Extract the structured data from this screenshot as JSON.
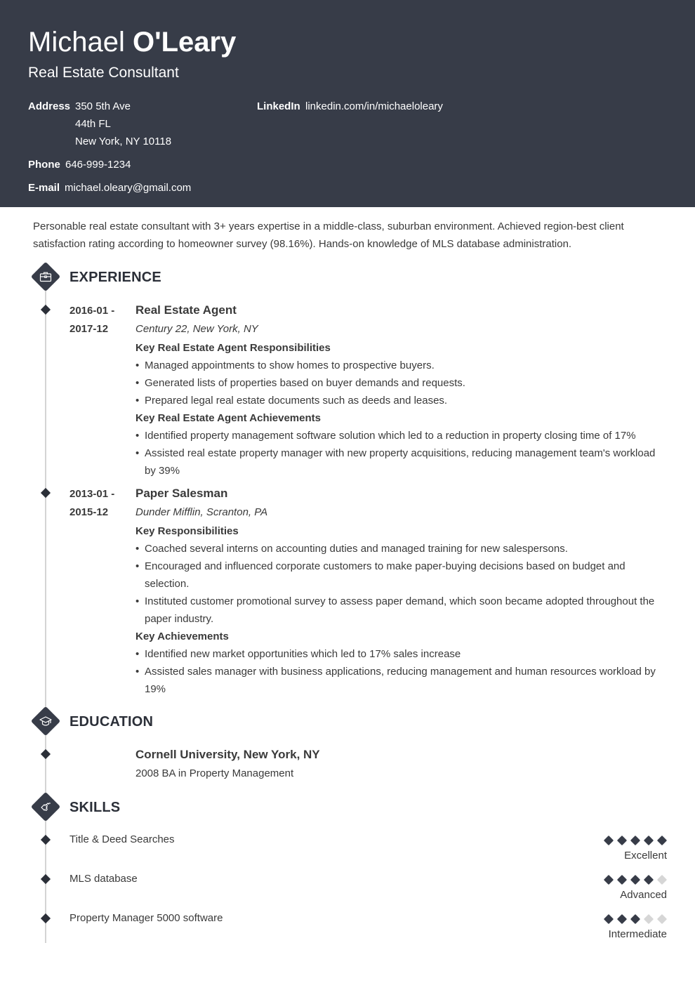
{
  "header": {
    "first_name": "Michael",
    "last_name": "O'Leary",
    "job_title": "Real Estate Consultant",
    "contact": {
      "address_label": "Address",
      "address_lines": [
        "350 5th Ave",
        "44th FL",
        "New York, NY 10118"
      ],
      "linkedin_label": "LinkedIn",
      "linkedin": "linkedin.com/in/michaeloleary",
      "phone_label": "Phone",
      "phone": "646-999-1234",
      "email_label": "E-mail",
      "email": "michael.oleary@gmail.com"
    }
  },
  "summary": "Personable real estate consultant with 3+ years expertise in a middle-class, suburban environment. Achieved region-best client satisfaction rating according to homeowner survey (98.16%). Hands-on knowledge of MLS database administration.",
  "sections": {
    "experience": "EXPERIENCE",
    "education": "EDUCATION",
    "skills": "SKILLS"
  },
  "experience": [
    {
      "date_start": "2016-01 -",
      "date_end": "2017-12",
      "role": "Real Estate Agent",
      "company": "Century 22, New York, NY",
      "resp_heading": "Key Real Estate Agent Responsibilities",
      "responsibilities": [
        "Managed appointments to show homes to prospective buyers.",
        "Generated lists of properties based on buyer demands and requests.",
        "Prepared legal real estate documents such as deeds and leases."
      ],
      "ach_heading": "Key Real Estate Agent Achievements",
      "achievements": [
        "Identified property management software solution which led to a reduction in property closing time of 17%",
        "Assisted real estate property manager with new property acquisitions, reducing management team's workload by 39%"
      ]
    },
    {
      "date_start": "2013-01 -",
      "date_end": "2015-12",
      "role": "Paper Salesman",
      "company": "Dunder Mifflin, Scranton, PA",
      "resp_heading": "Key Responsibilities",
      "responsibilities": [
        "Coached several interns on accounting duties and managed training for new salespersons.",
        "Encouraged and influenced corporate customers to make paper-buying decisions based on budget and selection.",
        "Instituted customer promotional survey to assess paper demand, which soon became adopted throughout the paper industry."
      ],
      "ach_heading": "Key Achievements",
      "achievements": [
        "Identified new market opportunities which led to 17% sales increase",
        "Assisted sales manager with business applications, reducing management and human resources workload by 19%"
      ]
    }
  ],
  "education": {
    "school": "Cornell University, New York, NY",
    "degree": "2008 BA in Property Management"
  },
  "skills": [
    {
      "name": "Title & Deed Searches",
      "rating": 5,
      "max": 5,
      "level": "Excellent"
    },
    {
      "name": "MLS database",
      "rating": 4,
      "max": 5,
      "level": "Advanced"
    },
    {
      "name": "Property Manager 5000 software",
      "rating": 3,
      "max": 5,
      "level": "Intermediate"
    }
  ],
  "colors": {
    "header_bg": "#373c48",
    "accent": "#373c48",
    "rating_off": "#d6d6d6",
    "timeline": "#d4d4d4"
  }
}
